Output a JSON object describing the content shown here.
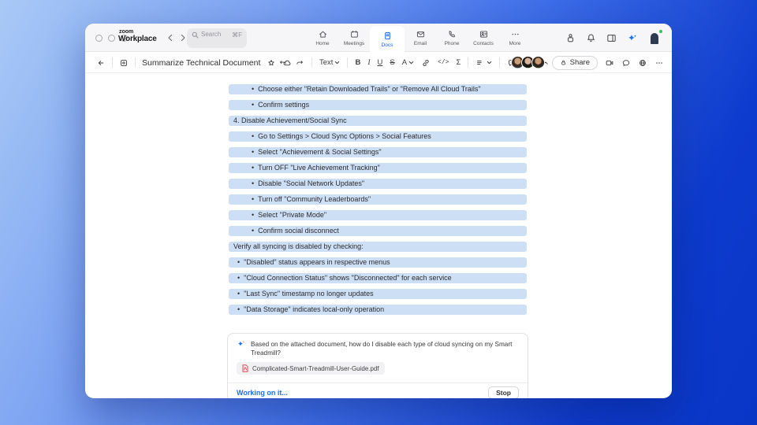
{
  "topbar": {
    "logo_top": "zoom",
    "logo_bottom": "Workplace",
    "search": {
      "placeholder": "Search",
      "shortcut": "⌘F"
    },
    "nav": [
      {
        "label": "Home"
      },
      {
        "label": "Meetings"
      },
      {
        "label": "Docs",
        "active": true
      },
      {
        "label": "Email"
      },
      {
        "label": "Phone"
      },
      {
        "label": "Contacts"
      },
      {
        "label": "More"
      }
    ]
  },
  "doc_toolbar": {
    "title": "Summarize Technical Document",
    "text_style": "Text",
    "bold": "B",
    "italic": "I",
    "underline": "U",
    "strike": "S",
    "text_color": "A",
    "code": "</>",
    "formula": "Σ",
    "share": "Share"
  },
  "document": {
    "bullet_char": "•",
    "rows": [
      {
        "text": "Choose either \"Retain Downloaded Trails\" or \"Remove All Cloud Trails\"",
        "style": "bullet-deep"
      },
      {
        "text": "Confirm settings",
        "style": "bullet-deep"
      },
      {
        "text": "4. Disable Achievement/Social Sync",
        "style": "plain"
      },
      {
        "text": "Go to Settings > Cloud Sync Options > Social Features",
        "style": "bullet-deep"
      },
      {
        "text": "Select \"Achievement & Social Settings\"",
        "style": "bullet-deep"
      },
      {
        "text": "Turn OFF \"Live Achievement Tracking\"",
        "style": "bullet-deep"
      },
      {
        "text": "Disable \"Social Network Updates\"",
        "style": "bullet-deep"
      },
      {
        "text": "Turn off \"Community Leaderboards\"",
        "style": "bullet-deep"
      },
      {
        "text": "Select \"Private Mode\"",
        "style": "bullet-deep"
      },
      {
        "text": "Confirm social disconnect",
        "style": "bullet-deep"
      },
      {
        "text": "Verify all syncing is disabled by checking:",
        "style": "plain"
      },
      {
        "text": "\"Disabled\" status appears in respective menus",
        "style": "bullet"
      },
      {
        "text": "\"Cloud Connection Status\" shows \"Disconnected\" for each service",
        "style": "bullet"
      },
      {
        "text": "\"Last Sync\" timestamp no longer updates",
        "style": "bullet"
      },
      {
        "text": "\"Data Storage\" indicates local-only operation",
        "style": "bullet"
      }
    ]
  },
  "ai_card": {
    "question": "Based on the attached document, how do I disable each type of cloud syncing on my Smart Treadmill?",
    "attachment": "Complicated-Smart-Treadmill-User-Guide.pdf",
    "status": "Working on it...",
    "stop": "Stop"
  },
  "colors": {
    "accent_blue": "#0b5cff",
    "ai_blue": "#1a6ef5",
    "highlight": "#cddff5",
    "pdf_red": "#e5484d",
    "presence_green": "#34c759"
  }
}
